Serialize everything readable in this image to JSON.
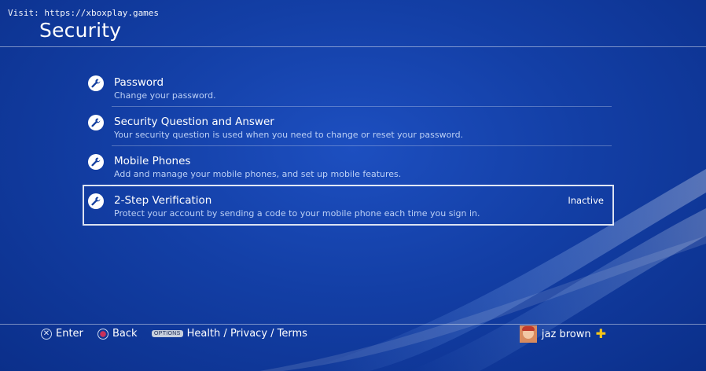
{
  "watermark": "Visit: https://xboxplay.games",
  "page": {
    "title": "Security"
  },
  "menu": {
    "items": [
      {
        "title": "Password",
        "description": "Change your password.",
        "icon": "wrench-icon"
      },
      {
        "title": "Security Question and Answer",
        "description": "Your security question is used when you need to change or reset your password.",
        "icon": "wrench-icon"
      },
      {
        "title": "Mobile Phones",
        "description": "Add and manage your mobile phones, and set up mobile features.",
        "icon": "wrench-icon"
      },
      {
        "title": "2-Step Verification",
        "description": "Protect your account by sending a code to your mobile phone each time you sign in.",
        "icon": "wrench-icon",
        "status": "Inactive",
        "selected": true
      }
    ]
  },
  "footer": {
    "enter_label": "Enter",
    "back_label": "Back",
    "options_badge": "OPTIONS",
    "options_label": "Health / Privacy / Terms",
    "user_name": "jaz brown"
  },
  "colors": {
    "background": "#133fa6",
    "accent_plus": "#f5c518",
    "description_text": "#bcd0f5"
  }
}
